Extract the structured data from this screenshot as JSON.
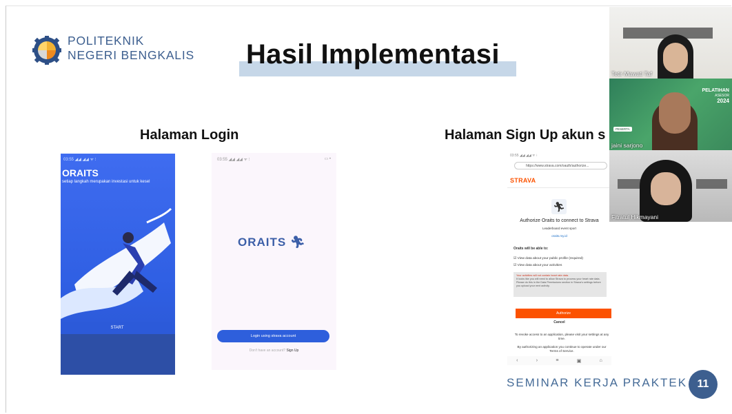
{
  "colors": {
    "brand": "#3d5f8f",
    "title_bar": "#c6d7e8",
    "app_blue": "#2e5fdc",
    "strava_orange": "#fc5200"
  },
  "header": {
    "org_line1": "POLITEKNIK",
    "org_line2": "NEGERI BENGKALIS",
    "title": "Hasil Implementasi"
  },
  "sections": {
    "login": "Halaman Login",
    "signup": "Halaman Sign Up akun s"
  },
  "login_screen1": {
    "status": "03:55 ◢◢ ◢◢ ᯤ ⁝",
    "app_name": "ORAITS",
    "tagline": "setiap langkah merupakan investasi untuk kesel",
    "start_label": "START"
  },
  "login_screen2": {
    "status": "03:55 ◢◢ ◢◢ ᯤ ⁝",
    "battery": "▭ •",
    "logo_text": "ORAITS",
    "login_button": "Login using strava account",
    "signup_prompt": "Don't have an account?",
    "signup_link": "Sign Up"
  },
  "strava": {
    "status": "03:55 ◢◢ ◢◢ ᯤ ⁝",
    "url": "https://www.strava.com/oauth/authorize...",
    "brand": "STRAVA",
    "authorize_title": "Authorize Oraits to connect to Strava",
    "app_sub": "Leaderboard event sport",
    "app_link": "oraits.my.id",
    "able_header": "Oraits will be able to:",
    "perm1": "View data about your public profile (required)",
    "perm2": "View data about your activities",
    "warning_title": "Your activities will not contain heart rate data.",
    "warning_text": "It looks like you will need to allow Strava to process your heart rate data. Please do this in the Data Permissions section in Strava's settings before you upload your next activity.",
    "authorize_button": "Authorize",
    "cancel": "Cancel",
    "revoke_text": "To revoke access to an application, please visit your settings at any time.",
    "terms_text": "By authorizing an application you continue to operate under our Terms of Service."
  },
  "participants": [
    {
      "name": "Tetir Mawati Taf"
    },
    {
      "name": "jaini sarjono",
      "banner_title": "PELATIHAN",
      "banner_sub": "ASESOR",
      "banner_year": "2024",
      "badge": "PESERTA"
    },
    {
      "name": "Fitratul Hikmayani"
    }
  ],
  "footer": {
    "text": "SEMINAR KERJA PRAKTEK",
    "page": "11"
  }
}
